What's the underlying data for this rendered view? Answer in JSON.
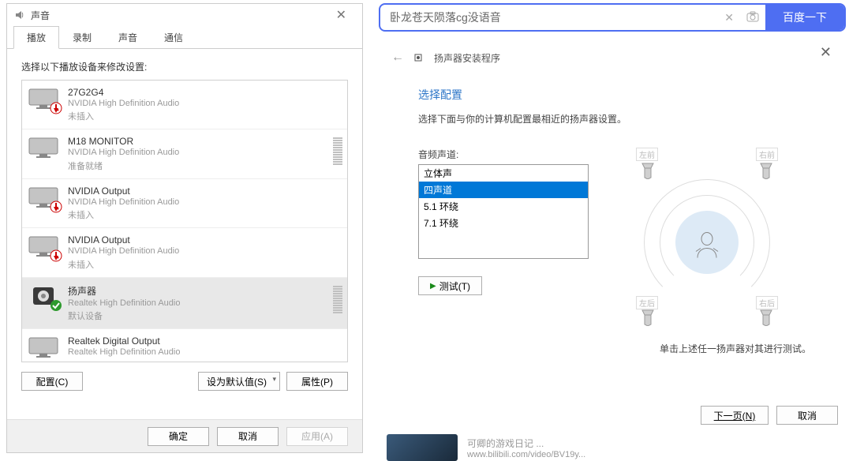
{
  "sound_dialog": {
    "title": "声音",
    "tabs": [
      "播放",
      "录制",
      "声音",
      "通信"
    ],
    "active_tab": 0,
    "instruction": "选择以下播放设备来修改设置:",
    "devices": [
      {
        "name": "27G2G4",
        "desc": "NVIDIA High Definition Audio",
        "status": "未插入",
        "badge": "unplugged"
      },
      {
        "name": "M18  MONITOR",
        "desc": "NVIDIA High Definition Audio",
        "status": "准备就绪",
        "badge": "none",
        "meter": true
      },
      {
        "name": "NVIDIA Output",
        "desc": "NVIDIA High Definition Audio",
        "status": "未插入",
        "badge": "unplugged"
      },
      {
        "name": "NVIDIA Output",
        "desc": "NVIDIA High Definition Audio",
        "status": "未插入",
        "badge": "unplugged"
      },
      {
        "name": "扬声器",
        "desc": "Realtek High Definition Audio",
        "status": "默认设备",
        "badge": "default",
        "meter": true,
        "selected": true,
        "speaker_icon": true
      },
      {
        "name": "Realtek Digital Output",
        "desc": "Realtek High Definition Audio",
        "status": "",
        "badge": "none"
      }
    ],
    "btn_configure": "配置(C)",
    "btn_set_default": "设为默认值(S)",
    "btn_properties": "属性(P)",
    "btn_ok": "确定",
    "btn_cancel": "取消",
    "btn_apply": "应用(A)"
  },
  "search": {
    "value": "卧龙苍天陨落cg没语音",
    "button": "百度一下"
  },
  "wizard": {
    "crumb": "扬声器安装程序",
    "heading": "选择配置",
    "subtitle": "选择下面与你的计算机配置最相近的扬声器设置。",
    "channel_label": "音频声道:",
    "options": [
      "立体声",
      "四声道",
      "5.1 环绕",
      "7.1 环绕"
    ],
    "selected_index": 1,
    "test": "测试(T)",
    "positions": {
      "fl": "左前",
      "fr": "右前",
      "rl": "左后",
      "rr": "右后"
    },
    "hint": "单击上述任一扬声器对其进行测试。",
    "btn_next": "下一页(N)",
    "btn_cancel": "取消"
  },
  "clip": {
    "title": "可卿的游戏日记 ...",
    "url": "www.bilibili.com/video/BV19y..."
  }
}
